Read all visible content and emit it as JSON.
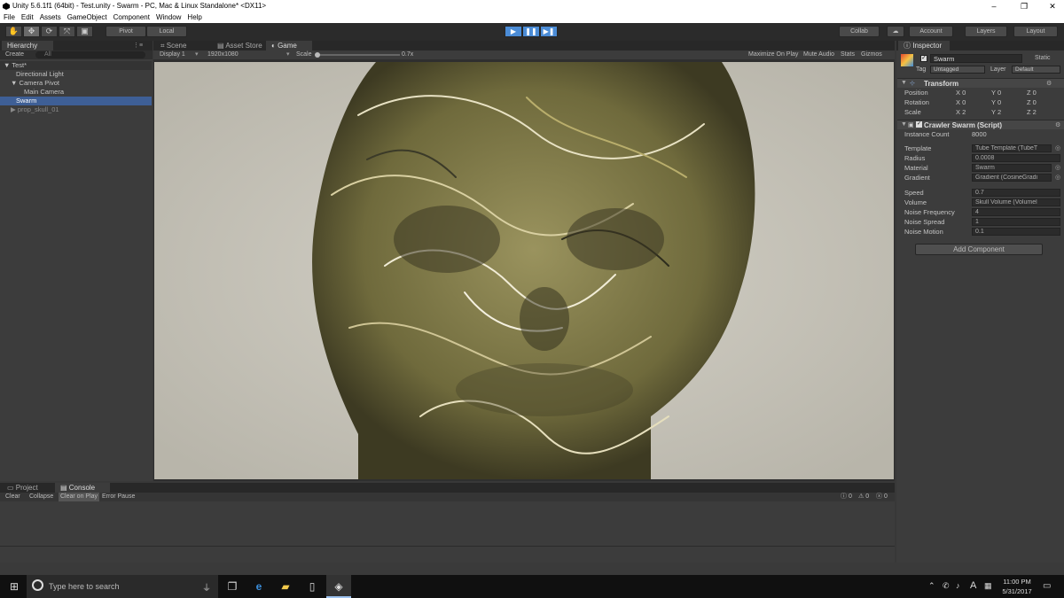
{
  "window": {
    "title": "Unity 5.6.1f1 (64bit) - Test.unity - Swarm - PC, Mac & Linux Standalone* <DX11>",
    "minimize": "–",
    "restore": "❐",
    "close": "✕"
  },
  "menu": [
    "File",
    "Edit",
    "Assets",
    "GameObject",
    "Component",
    "Window",
    "Help"
  ],
  "toolbar": {
    "pivot": "Pivot",
    "local": "Local",
    "collab": "Collab",
    "account": "Account",
    "layers": "Layers",
    "layout": "Layout",
    "play": "▶",
    "pause": "❚❚",
    "step": "▶❚",
    "tools": [
      "✋",
      "✥",
      "⟳",
      "⤧",
      "▣"
    ],
    "dropdown_arrow": "▾",
    "cloud": "☁"
  },
  "hierarchy": {
    "tab": "Hierarchy",
    "create": "Create",
    "search_placeholder": "All",
    "items": [
      {
        "label": "Test*",
        "arrow": "▼"
      },
      {
        "label": "Directional Light"
      },
      {
        "label": "Camera Pivot",
        "arrow": "▼"
      },
      {
        "label": "Main Camera"
      },
      {
        "label": "Swarm"
      },
      {
        "label": "prop_skull_01",
        "arrow": "▶"
      }
    ],
    "lock": "⋮≡"
  },
  "center_tabs": {
    "scene": "Scene",
    "asset_store": "Asset Store",
    "game": "Game"
  },
  "game_bar": {
    "display": "Display 1",
    "resolution": "1920x1080",
    "scale_label": "Scale",
    "scale_value": "0.7x",
    "maximize": "Maximize On Play",
    "mute": "Mute Audio",
    "stats": "Stats",
    "gizmos": "Gizmos"
  },
  "inspector": {
    "tab": "Inspector",
    "object_name": "Swarm",
    "static": "Static",
    "tag_label": "Tag",
    "tag_value": "Untagged",
    "layer_label": "Layer",
    "layer_value": "Default",
    "check": "✓",
    "transform": {
      "header": "Transform",
      "rows": [
        {
          "label": "Position",
          "x": "0",
          "y": "0",
          "z": "0"
        },
        {
          "label": "Rotation",
          "x": "0",
          "y": "0",
          "z": "0"
        },
        {
          "label": "Scale",
          "x": "2",
          "y": "2",
          "z": "2"
        }
      ]
    },
    "component": {
      "header": "Crawler Swarm (Script)",
      "rows": [
        {
          "label": "Instance Count",
          "value": "8000"
        },
        {
          "label": "Template",
          "value": "Tube Template (TubeT"
        },
        {
          "label": "Radius",
          "value": "0.0008"
        },
        {
          "label": "Material",
          "value": "Swarm"
        },
        {
          "label": "Gradient",
          "value": "Gradient (CosineGradi"
        },
        {
          "label": "Speed",
          "value": "0.7"
        },
        {
          "label": "Volume",
          "value": "Skull Volume (Volumel"
        },
        {
          "label": "Noise Frequency",
          "value": "4"
        },
        {
          "label": "Noise Spread",
          "value": "1"
        },
        {
          "label": "Noise Motion",
          "value": "0.1"
        }
      ]
    },
    "add_component": "Add Component"
  },
  "bottom": {
    "project_tab": "Project",
    "console_tab": "Console",
    "clear": "Clear",
    "collapse": "Collapse",
    "clear_on_play": "Clear on Play",
    "error_pause": "Error Pause",
    "counts": [
      "0",
      "0",
      "0"
    ]
  },
  "taskbar": {
    "search_placeholder": "Type here to search",
    "time": "11:00 PM",
    "date": "5/31/2017",
    "lang": "A"
  },
  "colors": {
    "accent": "#3e5f96",
    "play_blue": "#4b8cd6",
    "panel": "#3c3c3c",
    "viewport_bg": "#c7c4ba"
  }
}
